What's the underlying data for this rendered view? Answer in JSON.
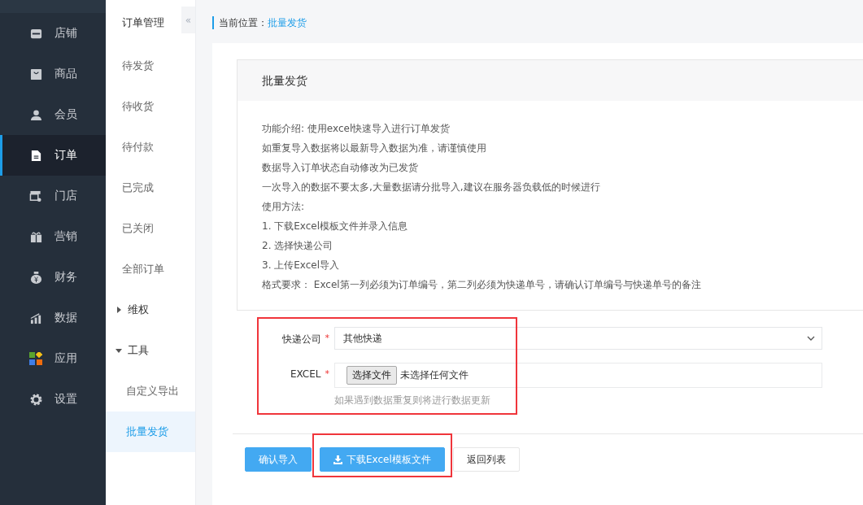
{
  "nav": {
    "items": [
      {
        "label": "店铺",
        "selected": false
      },
      {
        "label": "商品",
        "selected": false
      },
      {
        "label": "会员",
        "selected": false
      },
      {
        "label": "订单",
        "selected": true
      },
      {
        "label": "门店",
        "selected": false
      },
      {
        "label": "营销",
        "selected": false
      },
      {
        "label": "财务",
        "selected": false
      },
      {
        "label": "数据",
        "selected": false
      },
      {
        "label": "应用",
        "selected": false
      },
      {
        "label": "设置",
        "selected": false
      }
    ]
  },
  "subnav": {
    "title": "订单管理",
    "collapse": "«",
    "items": [
      {
        "kind": "link",
        "label": "待发货",
        "selected": false
      },
      {
        "kind": "link",
        "label": "待收货",
        "selected": false
      },
      {
        "kind": "link",
        "label": "待付款",
        "selected": false
      },
      {
        "kind": "link",
        "label": "已完成",
        "selected": false
      },
      {
        "kind": "link",
        "label": "已关闭",
        "selected": false
      },
      {
        "kind": "link",
        "label": "全部订单",
        "selected": false
      },
      {
        "kind": "group",
        "label": "维权",
        "expanded": false
      },
      {
        "kind": "group",
        "label": "工具",
        "expanded": true,
        "children": [
          {
            "label": "自定义导出",
            "selected": false
          },
          {
            "label": "批量发货",
            "selected": true
          }
        ]
      }
    ]
  },
  "breadcrumb": {
    "label": "当前位置：",
    "current": "批量发货"
  },
  "panel": {
    "title": "批量发货",
    "lines": [
      "功能介绍: 使用excel快速导入进行订单发货",
      "如重复导入数据将以最新导入数据为准，请谨慎使用",
      "数据导入订单状态自动修改为已发货",
      "一次导入的数据不要太多,大量数据请分批导入,建议在服务器负载低的时候进行",
      "使用方法:",
      "1. 下载Excel模板文件并录入信息",
      "2. 选择快递公司",
      "3. 上传Excel导入",
      "格式要求： Excel第一列必须为订单编号，第二列必须为快递单号，请确认订单编号与快递单号的备注"
    ]
  },
  "form": {
    "highlighted": true,
    "fields": [
      {
        "kind": "select",
        "label": "快递公司",
        "required_mark": "*",
        "value": "其他快递"
      },
      {
        "kind": "file",
        "label": "EXCEL",
        "required_mark": "*",
        "button": "选择文件",
        "status": "未选择任何文件",
        "hint": "如果遇到数据重复则将进行数据更新"
      }
    ]
  },
  "buttons": [
    {
      "kind": "primary",
      "label": "确认导入",
      "highlighted": false
    },
    {
      "kind": "download",
      "label": "下载Excel模板文件",
      "highlighted": true
    },
    {
      "kind": "plain",
      "label": "返回列表",
      "highlighted": false
    }
  ]
}
